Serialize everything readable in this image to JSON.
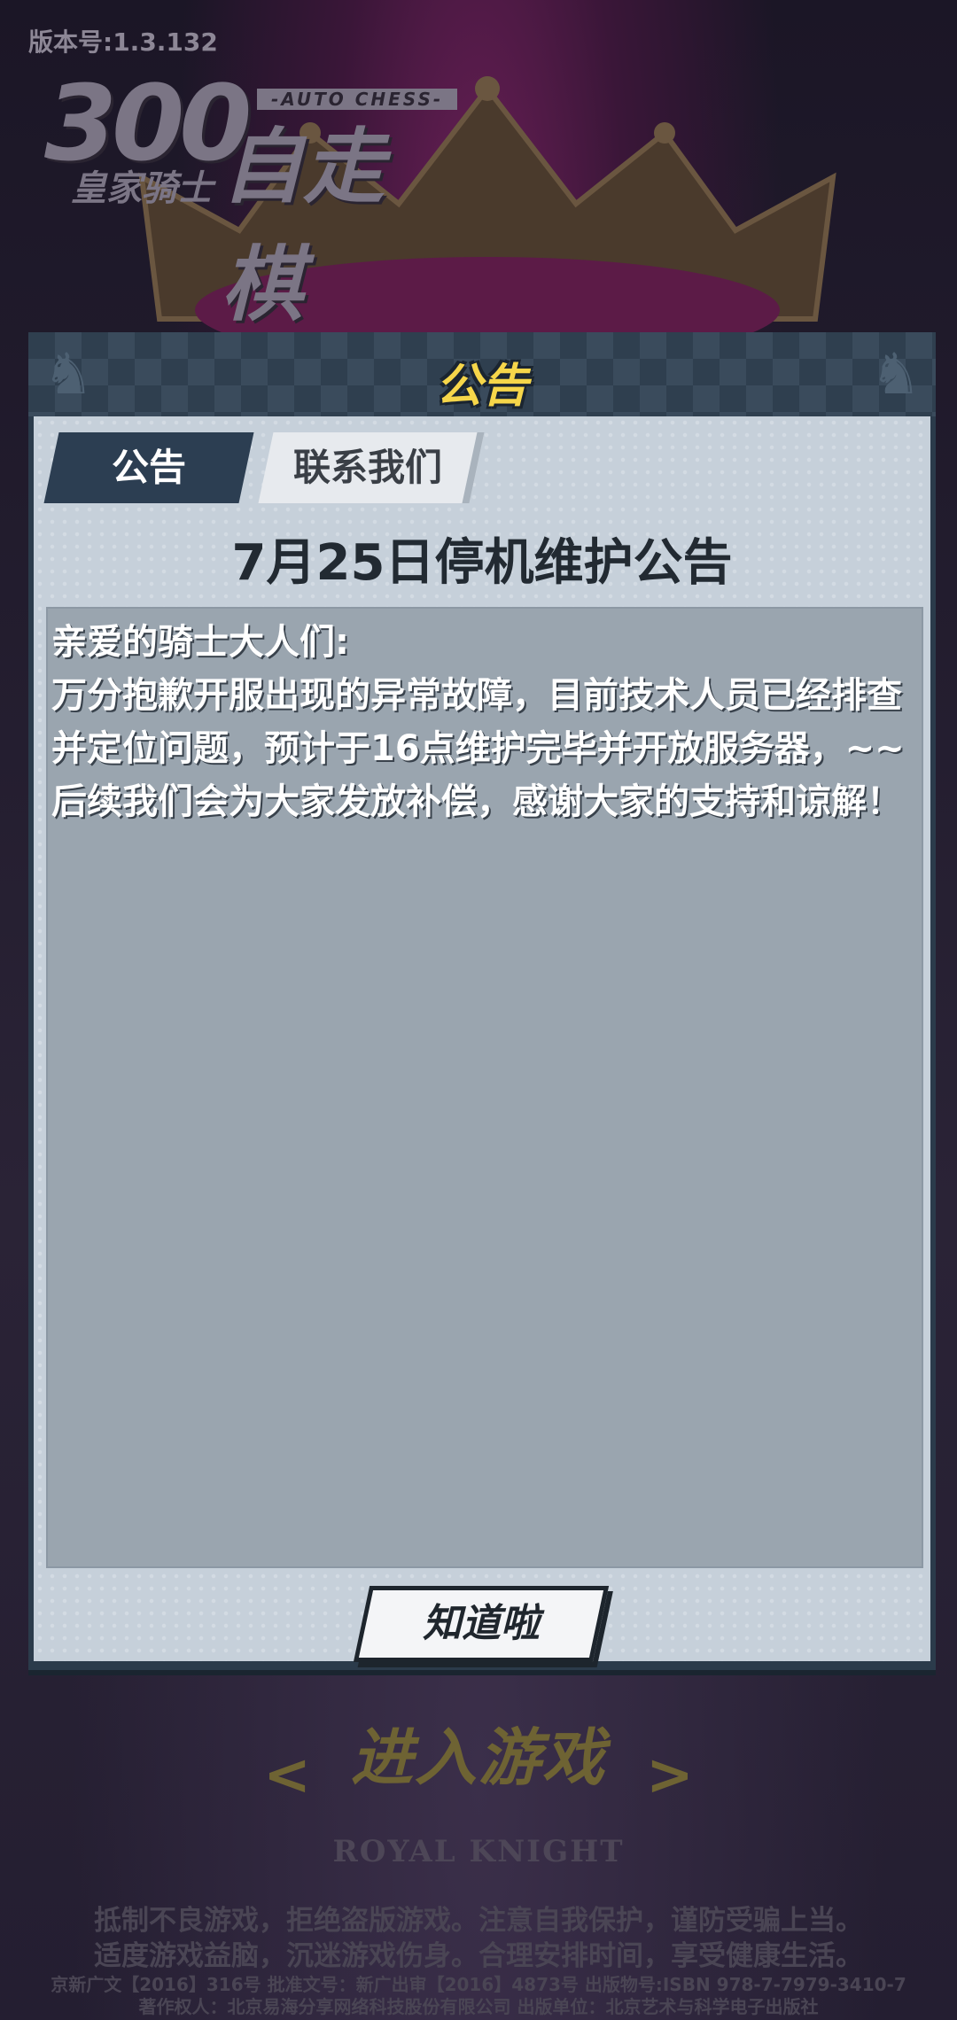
{
  "version": "版本号:1.3.132",
  "logo": {
    "number": "300",
    "title": "自走棋",
    "subtitle": "皇家骑士",
    "tag": "-AUTO CHESS-"
  },
  "panel": {
    "title": "公告",
    "tabs": [
      {
        "label": "公告",
        "active": true
      },
      {
        "label": "联系我们",
        "active": false
      }
    ],
    "notice_title": "7月25日停机维护公告",
    "content": [
      "亲爱的骑士大人们:",
      "万分抱歉开服出现的异常故障，目前技术人员已经排查并定位问题，预计于16点维护完毕并开放服务器，~~后续我们会为大家发放补偿，感谢大家的支持和谅解！"
    ],
    "ok_label": "知道啦"
  },
  "enter_game": {
    "label": "进入游戏",
    "left_arrow": "<",
    "right_arrow": ">"
  },
  "royal_knight": "ROYAL KNIGHT",
  "footer": {
    "line1": "抵制不良游戏，拒绝盗版游戏。注意自我保护，谨防受骗上当。",
    "line2": "适度游戏益脑，沉迷游戏伤身。合理安排时间，享受健康生活。",
    "line3": "京新广文【2016】316号  批准文号：新广出审【2016】4873号  出版物号:ISBN 978-7-7979-3410-7",
    "line4": "著作权人：北京易海分享网络科技股份有限公司  出版单位：北京艺术与科学电子出版社"
  },
  "colors": {
    "panel_dark": "#2b3b4b",
    "panel_title": "#f6d64a",
    "content_bg": "#9aa5af",
    "tab_active": "#2c3e52"
  },
  "icons": [
    "knight-left-icon",
    "knight-right-icon",
    "crown-icon"
  ]
}
